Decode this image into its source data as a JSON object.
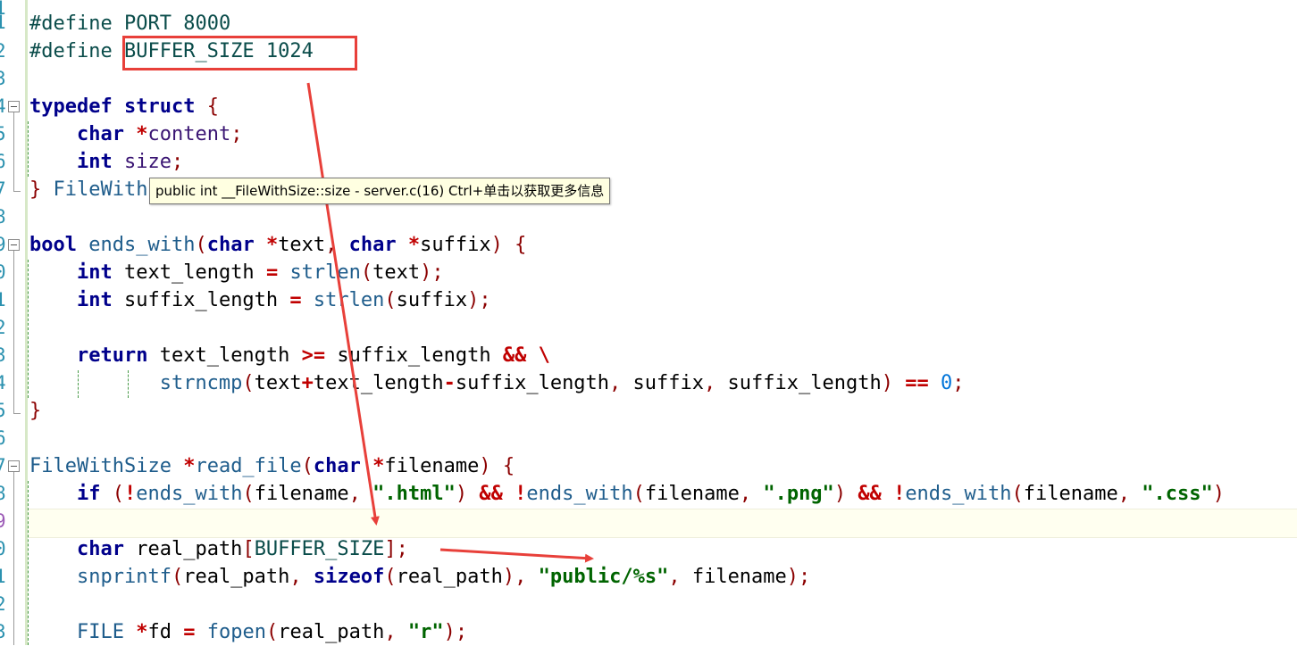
{
  "gutter": {
    "line_numbers": [
      "1",
      "2",
      "3",
      "4",
      "5",
      "6",
      "7",
      "8",
      "9",
      "0",
      "1",
      "2",
      "3",
      "4",
      "5",
      "6",
      "7",
      "8",
      "9",
      "0",
      "1",
      "2",
      "3"
    ]
  },
  "code": {
    "line1": {
      "a": "#define",
      "b": "PORT",
      "c": "8000"
    },
    "line2": {
      "a": "#define",
      "b": "BUFFER_SIZE",
      "c": "1024"
    },
    "line4": {
      "kw1": "typedef",
      "kw2": "struct",
      "brace": "{"
    },
    "line5": {
      "kw": "char",
      "star": "*",
      "name": "content",
      "semi": ";"
    },
    "line6": {
      "kw": "int",
      "name": "size",
      "semi": ";"
    },
    "line7": {
      "brace": "}",
      "name": "FileWith"
    },
    "line9": {
      "kw": "bool",
      "fn": "ends_with",
      "p1": "(",
      "kw2": "char",
      "star1": "*",
      "a1": "text",
      "comma": ",",
      "kw3": "char",
      "star2": "*",
      "a2": "suffix",
      "p2": ")",
      "brace": "{"
    },
    "line10": {
      "kw": "int",
      "name": "text_length",
      "eq": "=",
      "fn": "strlen",
      "p1": "(",
      "arg": "text",
      "p2": ")",
      "semi": ";"
    },
    "line11": {
      "kw": "int",
      "name": "suffix_length",
      "eq": "=",
      "fn": "strlen",
      "p1": "(",
      "arg": "suffix",
      "p2": ")",
      "semi": ";"
    },
    "line13": {
      "kw": "return",
      "a": "text_length",
      "op": ">=",
      "b": "suffix_length",
      "and": "&&",
      "bs": "\\"
    },
    "line14": {
      "fn": "strncmp",
      "p1": "(",
      "a": "text",
      "plus": "+",
      "b": "text_length",
      "minus": "-",
      "c": "suffix_length",
      "comma1": ",",
      "d": "suffix",
      "comma2": ",",
      "e": "suffix_length",
      "p2": ")",
      "eq": "==",
      "zero": "0",
      "semi": ";"
    },
    "line15": {
      "brace": "}"
    },
    "line17": {
      "type": "FileWithSize",
      "star": "*",
      "fn": "read_file",
      "p1": "(",
      "kw": "char",
      "star2": "*",
      "arg": "filename",
      "p2": ")",
      "brace": "{"
    },
    "line18": {
      "kw": "if",
      "p1": "(",
      "not1": "!",
      "fn1": "ends_with",
      "p2": "(",
      "a1": "filename",
      "c1": ",",
      "s1": "\".html\"",
      "p3": ")",
      "and1": "&&",
      "not2": "!",
      "fn2": "ends_with",
      "p4": "(",
      "a2": "filename",
      "c2": ",",
      "s2": "\".png\"",
      "p5": ")",
      "and2": "&&",
      "not3": "!",
      "fn3": "ends_with",
      "p6": "(",
      "a3": "filename",
      "c3": ",",
      "s3": "\".css\"",
      "p7": ")"
    },
    "line20": {
      "kw": "char",
      "name": "real_path",
      "b1": "[",
      "size": "BUFFER_SIZE",
      "b2": "]",
      "semi": ";"
    },
    "line21": {
      "fn": "snprintf",
      "p1": "(",
      "a": "real_path",
      "c1": ",",
      "kw": "sizeof",
      "p2": "(",
      "b": "real_path",
      "p3": ")",
      "c2": ",",
      "s": "\"public/%s\"",
      "c3": ",",
      "d": "filename",
      "p4": ")",
      "semi": ";"
    },
    "line23": {
      "type": "FILE",
      "star": "*",
      "name": "fd",
      "eq": "=",
      "fn": "fopen",
      "p1": "(",
      "a": "real_path",
      "c1": ",",
      "s": "\"r\"",
      "p2": ")",
      "semi": ";"
    }
  },
  "tooltip": {
    "text": "public int __FileWithSize::size - server.c(16) Ctrl+单击以获取更多信息"
  },
  "colors": {
    "annotation": "#e8403a",
    "tooltip_bg": "#ffffe1",
    "line_number": "#2b91af"
  }
}
